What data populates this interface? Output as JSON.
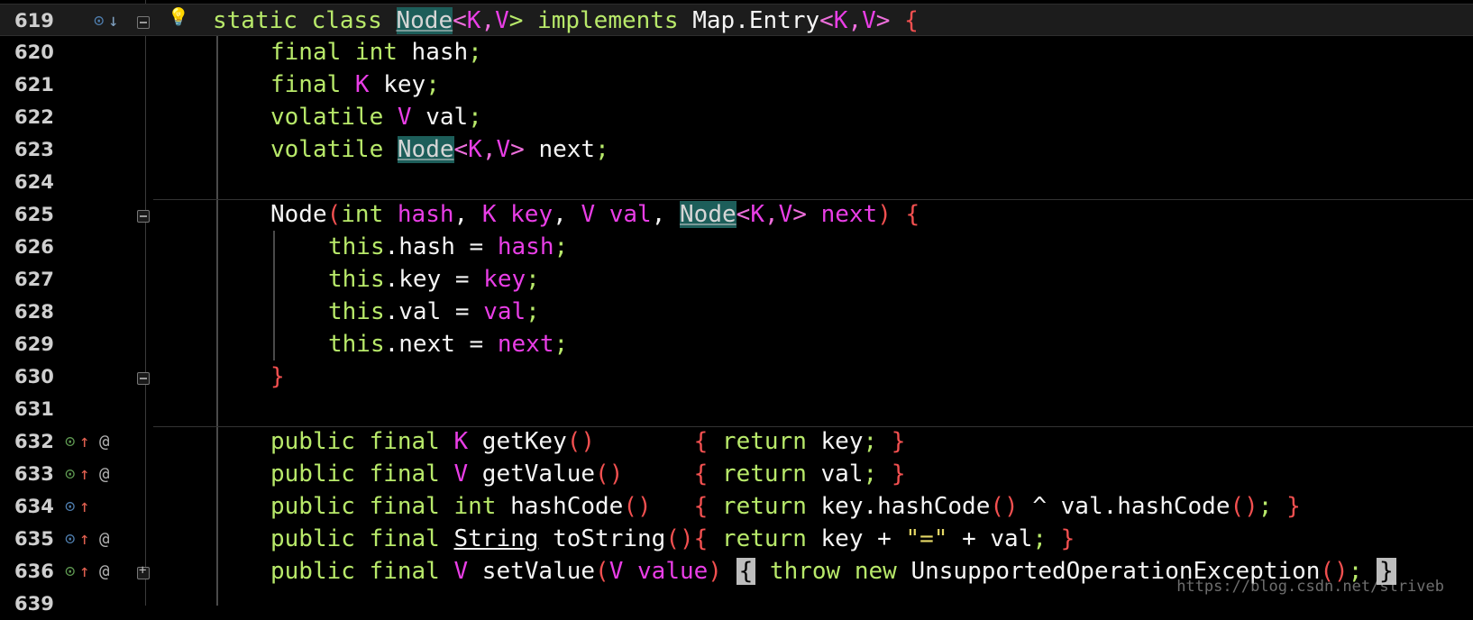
{
  "gutter": {
    "line_numbers": [
      "619",
      "620",
      "621",
      "622",
      "623",
      "624",
      "625",
      "626",
      "627",
      "628",
      "629",
      "630",
      "631",
      "632",
      "633",
      "634",
      "635",
      "636",
      "639"
    ]
  },
  "code": {
    "l619": {
      "a": "static class ",
      "b": "Node",
      "c": "<",
      "d": "K",
      "e": ",",
      "f": "V",
      "g": "> implements ",
      "h": "Map.Entry",
      "i": "<",
      "j": "K",
      "k": ",",
      "l": "V",
      "m": "> ",
      "n": "{"
    },
    "l620": {
      "a": "final int ",
      "b": "hash",
      "c": ";"
    },
    "l621": {
      "a": "final ",
      "b": "K",
      "c": " key",
      "d": ";"
    },
    "l622": {
      "a": "volatile ",
      "b": "V",
      "c": " val",
      "d": ";"
    },
    "l623": {
      "a": "volatile ",
      "b": "Node",
      "c": "<",
      "d": "K",
      "e": ",",
      "f": "V",
      "g": "> ",
      "h": "next",
      "i": ";"
    },
    "l625": {
      "a": "Node",
      "b": "(",
      "c": "int ",
      "d": "hash",
      "e": ", ",
      "f": "K ",
      "g": "key",
      "h": ", ",
      "i": "V ",
      "j": "val",
      "k": ", ",
      "l": "Node",
      "m": "<",
      "n": "K",
      "o": ",",
      "p": "V",
      "q": "> ",
      "r": "next",
      "s": ") ",
      "t": "{"
    },
    "l626": {
      "a": "this",
      "b": ".hash = ",
      "c": "hash",
      "d": ";"
    },
    "l627": {
      "a": "this",
      "b": ".key = ",
      "c": "key",
      "d": ";"
    },
    "l628": {
      "a": "this",
      "b": ".val = ",
      "c": "val",
      "d": ";"
    },
    "l629": {
      "a": "this",
      "b": ".next = ",
      "c": "next",
      "d": ";"
    },
    "l630": {
      "a": "}"
    },
    "l632": {
      "a": "public final ",
      "b": "K",
      "c": " getKey",
      "d": "()",
      "e": "       ",
      "f": "{",
      "g": " return ",
      "h": "key",
      "i": "; ",
      "j": "}"
    },
    "l633": {
      "a": "public final ",
      "b": "V",
      "c": " getValue",
      "d": "()",
      "e": "     ",
      "f": "{",
      "g": " return ",
      "h": "val",
      "i": "; ",
      "j": "}"
    },
    "l634": {
      "a": "public final int ",
      "b": "hashCode",
      "c": "()",
      "d": "   ",
      "e": "{",
      "f": " return ",
      "g": "key.hashCode",
      "h": "()",
      "i": " ^ ",
      "j": "val.hashCode",
      "k": "()",
      "l": "; ",
      "m": "}"
    },
    "l635": {
      "a": "public final ",
      "b": "String",
      "c": " toString",
      "d": "()",
      "e": "{",
      "f": " return ",
      "g": "key",
      "h": " + ",
      "i": "\"=\"",
      "j": " + ",
      "k": "val",
      "l": "; ",
      "m": "}"
    },
    "l636": {
      "a": "public final ",
      "b": "V",
      "c": " setValue",
      "d": "(",
      "e": "V ",
      "f": "value",
      "g": ")",
      "h": " ",
      "i": "{",
      "j": " throw new ",
      "k": "UnsupportedOperationException",
      "l": "()",
      "m": ";",
      "n": " ",
      "o": "}"
    }
  },
  "watermark": "https://blog.csdn.net/striveb",
  "icons": {
    "bulb": "💡",
    "override": "⊙",
    "down": "↓",
    "up": "↑",
    "at": "@"
  }
}
